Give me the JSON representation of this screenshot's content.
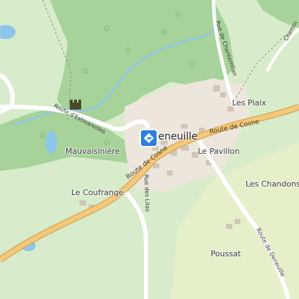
{
  "map": {
    "places": {
      "les_plaix": "Les Plaix",
      "le_pavillon": "Le Pavillon",
      "mauvaisiniere": "Mauvaisinière",
      "les_chandons": "Les Chandons",
      "le_coufrange": "Le Coufrange",
      "poussat": "Poussat",
      "village": "zeneuille"
    },
    "roads": {
      "route_de_cosne_east": "Route de Cosne",
      "route_de_cosne_west": "Route de Cosne",
      "route_estivareilles": "Route d'Estivareilles",
      "rue_des_lilas": "Rue des Lilas",
      "rue_chantemillan": "Rue de Chantemilan",
      "route_deneuille": "Route de Deneuille",
      "chemin": "Chemin"
    },
    "icons": {
      "poi": "location-pin-icon",
      "castle": "castle-icon"
    },
    "colors": {
      "forest": "#a7d39b",
      "meadow": "#d8eccb",
      "village": "#ede6dc",
      "water": "#8ec6ea",
      "road": "#f4c879",
      "road_casing": "#c89a4c",
      "marker": "#2d7fe0"
    }
  }
}
